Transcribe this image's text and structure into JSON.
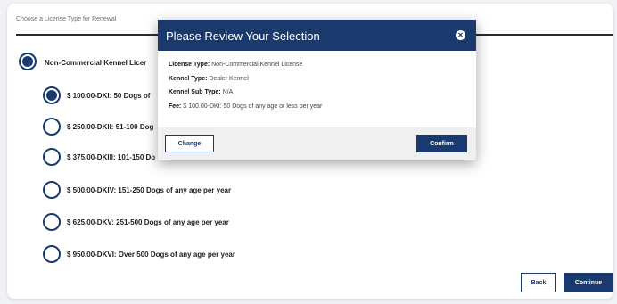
{
  "page": {
    "prompt": "Choose a License Type for Renewal"
  },
  "options": {
    "top_label": "Non-Commercial Kennel Licer",
    "items": [
      {
        "label": "$ 100.00-DKI: 50 Dogs of",
        "selected": true
      },
      {
        "label": "$ 250.00-DKII: 51-100 Dog",
        "selected": false
      },
      {
        "label": "$ 375.00-DKIII: 101-150 Do",
        "selected": false
      },
      {
        "label": "$ 500.00-DKIV: 151-250 Dogs of any age per year",
        "selected": false
      },
      {
        "label": "$ 625.00-DKV: 251-500 Dogs of any age per year",
        "selected": false
      },
      {
        "label": "$ 950.00-DKVI: Over 500 Dogs of any age per year",
        "selected": false
      }
    ]
  },
  "footer": {
    "back_label": "Back",
    "continue_label": "Continue"
  },
  "modal": {
    "title": "Please Review Your Selection",
    "close_glyph": "✕",
    "rows": [
      {
        "key": "License Type:",
        "value": "Non-Commercial Kennel License"
      },
      {
        "key": "Kennel Type:",
        "value": "Dealer Kennel"
      },
      {
        "key": "Kennel Sub Type:",
        "value": "N/A"
      },
      {
        "key": "Fee:",
        "value": "$ 100.00-DKI: 50 Dogs of any age or less per year"
      }
    ],
    "change_label": "Change",
    "confirm_label": "Confirm"
  },
  "colors": {
    "primary": "#1a3a6e",
    "footer_bg": "#f0f0f0"
  }
}
